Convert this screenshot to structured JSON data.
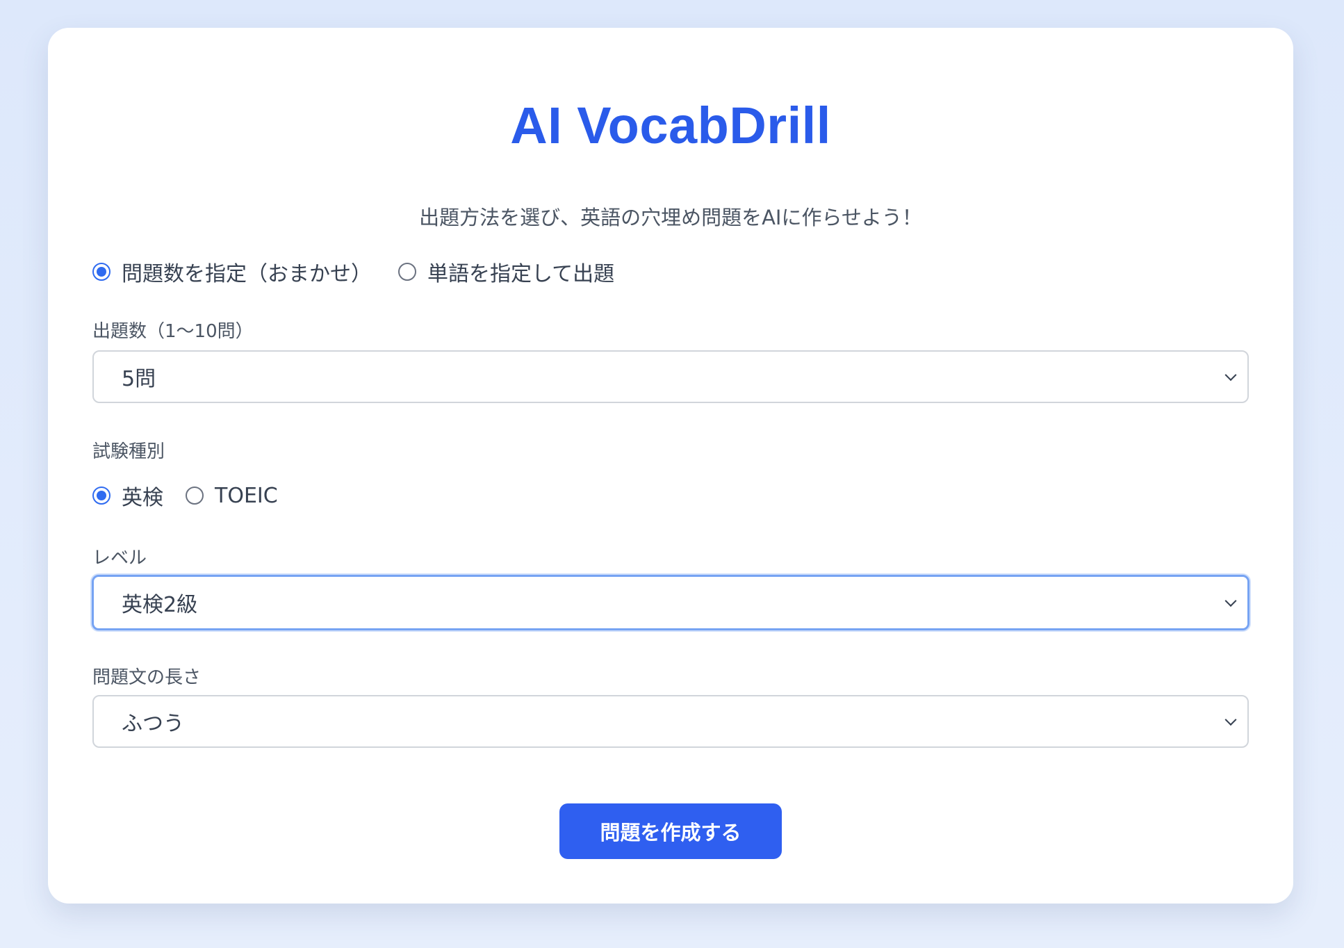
{
  "app": {
    "title": "AI VocabDrill",
    "subtitle": "出題方法を選び、英語の穴埋め問題をAIに作らせよう！"
  },
  "mode": {
    "options": [
      {
        "label": "問題数を指定（おまかせ）",
        "checked": true
      },
      {
        "label": "単語を指定して出題",
        "checked": false
      }
    ]
  },
  "question_count": {
    "label": "出題数（1〜10問）",
    "value": "5問"
  },
  "exam_type": {
    "label": "試験種別",
    "options": [
      {
        "label": "英検",
        "checked": true
      },
      {
        "label": "TOEIC",
        "checked": false
      }
    ]
  },
  "level": {
    "label": "レベル",
    "value": "英検2級"
  },
  "sentence_length": {
    "label": "問題文の長さ",
    "value": "ふつう"
  },
  "submit": {
    "label": "問題を作成する"
  },
  "colors": {
    "accent": "#2a5bea",
    "button": "#2f5ff0",
    "focus_ring": "#76a3f3",
    "background": "#dde8fb"
  }
}
